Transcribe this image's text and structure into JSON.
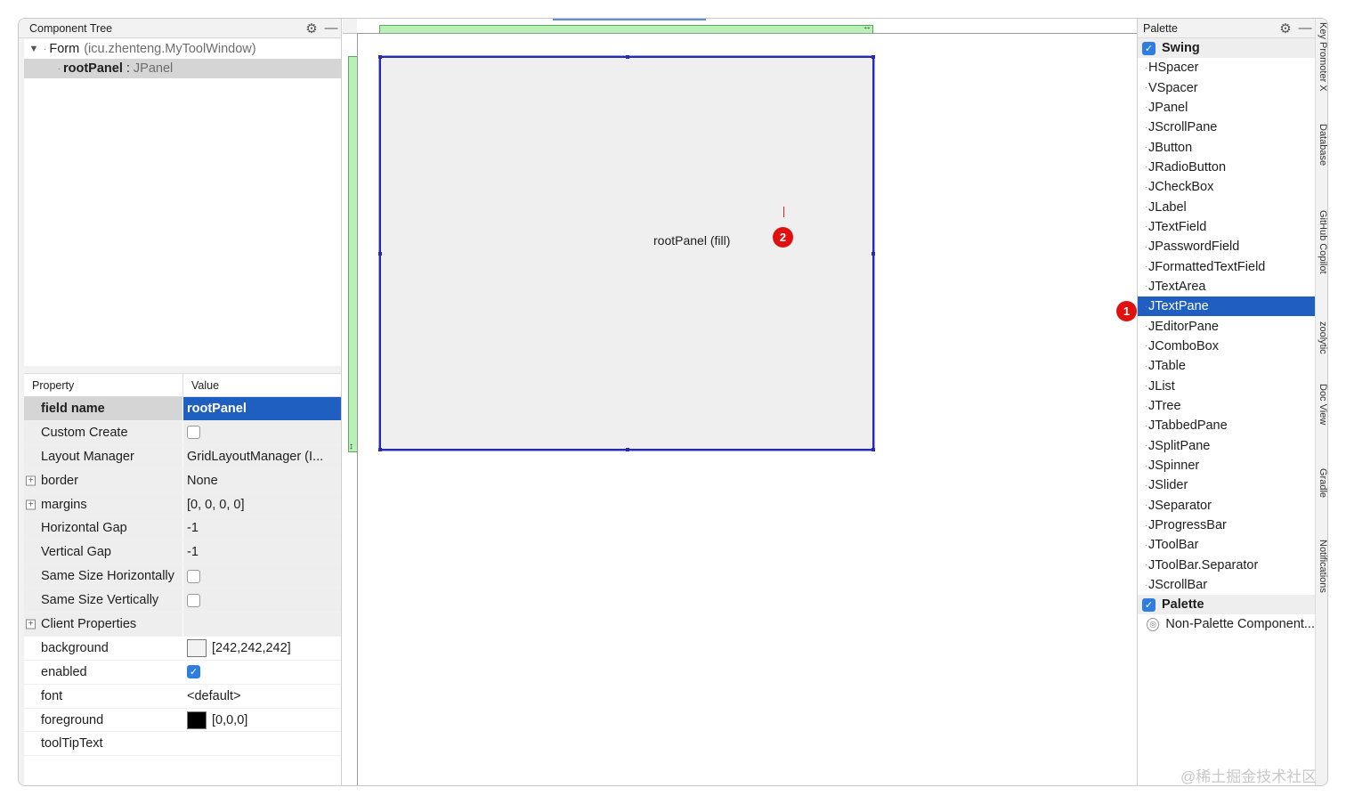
{
  "component_tree": {
    "title": "Component Tree",
    "form_label": "Form",
    "form_class": "(icu.zhenteng.MyToolWindow)",
    "root_name": "rootPanel",
    "root_sep": ":",
    "root_type": "JPanel"
  },
  "properties": {
    "header_property": "Property",
    "header_value": "Value",
    "rows": [
      {
        "name": "field name",
        "value": "rootPanel"
      },
      {
        "name": "Custom Create",
        "value": ""
      },
      {
        "name": "Layout Manager",
        "value": "GridLayoutManager (I..."
      },
      {
        "name": "border",
        "value": "None"
      },
      {
        "name": "margins",
        "value": "[0, 0, 0, 0]"
      },
      {
        "name": "Horizontal Gap",
        "value": "-1"
      },
      {
        "name": "Vertical Gap",
        "value": "-1"
      },
      {
        "name": "Same Size Horizontally",
        "value": ""
      },
      {
        "name": "Same Size Vertically",
        "value": ""
      },
      {
        "name": "Client Properties",
        "value": ""
      },
      {
        "name": "background",
        "value": "[242,242,242]"
      },
      {
        "name": "enabled",
        "value": ""
      },
      {
        "name": "font",
        "value": "<default>"
      },
      {
        "name": "foreground",
        "value": "[0,0,0]"
      },
      {
        "name": "toolTipText",
        "value": ""
      }
    ],
    "custom_create_checked": false,
    "same_size_h_checked": false,
    "same_size_v_checked": false,
    "enabled_checked": true,
    "background_swatch": "#f2f2f2",
    "foreground_swatch": "#000000"
  },
  "designer": {
    "panel_label": "rootPanel (fill)",
    "badge_2": "2"
  },
  "palette": {
    "title": "Palette",
    "swing_group": "Swing",
    "items": [
      "HSpacer",
      "VSpacer",
      "JPanel",
      "JScrollPane",
      "JButton",
      "JRadioButton",
      "JCheckBox",
      "JLabel",
      "JTextField",
      "JPasswordField",
      "JFormattedTextField",
      "JTextArea",
      "JTextPane",
      "JEditorPane",
      "JComboBox",
      "JTable",
      "JList",
      "JTree",
      "JTabbedPane",
      "JSplitPane",
      "JSpinner",
      "JSlider",
      "JSeparator",
      "JProgressBar",
      "JToolBar",
      "JToolBar.Separator",
      "JScrollBar"
    ],
    "selected_item": "JTextPane",
    "palette_group": "Palette",
    "non_palette": "Non-Palette Component...",
    "badge_1": "1"
  },
  "tool_stripe": {
    "items": [
      "Key Promoter X",
      "Database",
      "GitHub Copilot",
      "zoolytic",
      "Doc View",
      "Gradle",
      "Notifications"
    ]
  },
  "watermark": "@稀土掘金技术社区",
  "colors": {
    "selection": "#1f5fbf",
    "form_border": "#2a2ab0",
    "badge": "#e01010",
    "green_guide": "#b8f0b8"
  }
}
